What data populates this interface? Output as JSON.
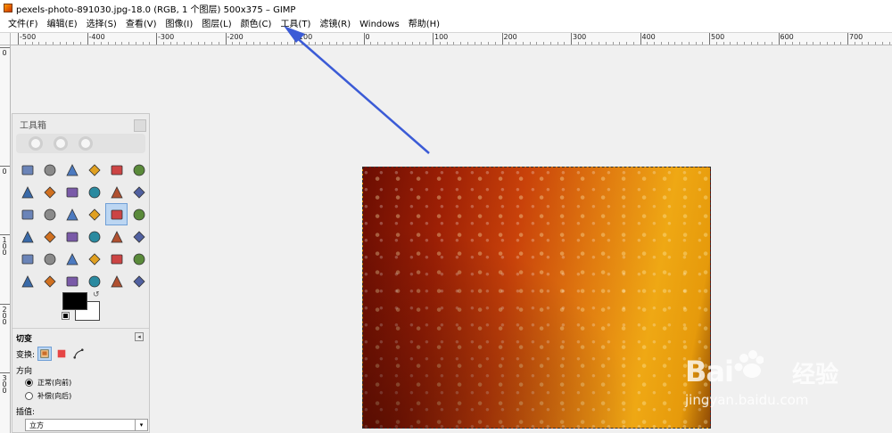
{
  "window": {
    "title": "pexels-photo-891030.jpg-18.0 (RGB, 1 个图层) 500x375 – GIMP"
  },
  "menu": [
    {
      "label": "文件(F)"
    },
    {
      "label": "编辑(E)"
    },
    {
      "label": "选择(S)"
    },
    {
      "label": "查看(V)"
    },
    {
      "label": "图像(I)"
    },
    {
      "label": "图层(L)"
    },
    {
      "label": "颜色(C)"
    },
    {
      "label": "工具(T)"
    },
    {
      "label": "滤镜(R)"
    },
    {
      "label": "Windows"
    },
    {
      "label": "帮助(H)"
    }
  ],
  "ruler": {
    "horizontal_labels": [
      "-500",
      "-400",
      "-300",
      "-200",
      "-100",
      "0",
      "100",
      "200",
      "300",
      "400",
      "500",
      "600",
      "700"
    ],
    "vertical_labels": [
      "0",
      "0",
      "100",
      "200",
      "300"
    ]
  },
  "toolbox": {
    "title": "工具箱",
    "tools": [
      {
        "icon": "rect-select-icon"
      },
      {
        "icon": "ellipse-select-icon"
      },
      {
        "icon": "free-select-icon"
      },
      {
        "icon": "fuzzy-select-icon"
      },
      {
        "icon": "color-select-icon"
      },
      {
        "icon": "scissors-select-icon"
      },
      {
        "icon": "foreground-select-icon"
      },
      {
        "icon": "paths-icon"
      },
      {
        "icon": "color-picker-icon"
      },
      {
        "icon": "zoom-tool-icon"
      },
      {
        "icon": "measure-icon"
      },
      {
        "icon": "move-icon"
      },
      {
        "icon": "align-icon"
      },
      {
        "icon": "crop-icon"
      },
      {
        "icon": "rotate-icon"
      },
      {
        "icon": "scale-icon"
      },
      {
        "icon": "shear-icon"
      },
      {
        "icon": "perspective-icon"
      },
      {
        "icon": "flip-icon"
      },
      {
        "icon": "cage-icon"
      },
      {
        "icon": "text-tool-icon"
      },
      {
        "icon": "bucket-fill-icon"
      },
      {
        "icon": "blend-icon"
      },
      {
        "icon": "pencil-icon"
      },
      {
        "icon": "paintbrush-icon"
      },
      {
        "icon": "eraser-icon"
      },
      {
        "icon": "airbrush-icon"
      },
      {
        "icon": "ink-icon"
      },
      {
        "icon": "clone-icon"
      },
      {
        "icon": "heal-icon"
      },
      {
        "icon": "smudge-icon"
      },
      {
        "icon": "blur-icon"
      },
      {
        "icon": "dodge-burn-icon"
      },
      {
        "icon": "magnify-icon"
      },
      {
        "icon": "warp-icon"
      },
      {
        "icon": "unified-transform-icon"
      }
    ],
    "active_tool": "shear-icon",
    "foreground_color": "#000000",
    "background_color": "#ffffff"
  },
  "tool_options": {
    "title": "切变",
    "transform_label": "变换:",
    "direction_label": "方向",
    "direction_normal": "正常(向前)",
    "direction_corrective": "补偿(向后)",
    "interpolation_label": "插值:",
    "interpolation_value": "立方"
  },
  "watermark": {
    "brand": "Bai",
    "brand_tail": "经验",
    "url": "jingyan.baidu.com"
  },
  "colors": {
    "arrow": "#3b5bd6"
  }
}
